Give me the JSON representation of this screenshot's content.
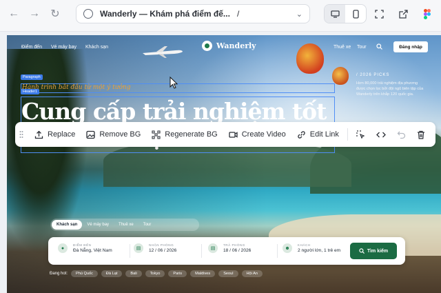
{
  "browser": {
    "url_title": "Wanderly — Khám phá điểm đế...",
    "url_path": "/",
    "icons": [
      "back-icon",
      "forward-icon",
      "reload-icon",
      "globe-icon",
      "chevron-down-icon",
      "desktop-icon",
      "mobile-icon",
      "fullscreen-icon",
      "external-link-icon",
      "figma-icon"
    ]
  },
  "site": {
    "nav_left": [
      "Điểm đến",
      "Vé máy bay",
      "Khách sạn"
    ],
    "brand": "Wanderly",
    "nav_right": [
      "Thuê xe",
      "Tour"
    ],
    "login": "Đăng nhập",
    "picks_title": "/ 2026 PICKS",
    "picks_desc": "Hơn 80,000 trải nghiệm địa phương được chọn lọc bởi đội ngũ biên tập của Wanderly trên khắp 120 quốc gia.",
    "tag_paragraph": "Paragraph",
    "tag_header": "Header1",
    "tagline": "Hành trình bắt đầu từ một ý tưởng",
    "hero_title": "Cung cấp trải nghiệm tốt nhất cho bạn",
    "tabs": [
      "Khách sạn",
      "Vé máy bay",
      "Thuê xe",
      "Tour"
    ],
    "search": {
      "dest_label": "ĐIỂM ĐẾN",
      "dest_value": "Đà Nẵng, Việt Nam",
      "checkin_label": "NHẬN PHÒNG",
      "checkin_value": "12 / 06 / 2026",
      "checkout_label": "TRẢ PHÒNG",
      "checkout_value": "18 / 06 / 2026",
      "guests_label": "KHÁCH",
      "guests_value": "2 người lớn, 1 trẻ em",
      "button": "Tìm kiếm"
    },
    "hot_label": "Đang hot:",
    "hot_chips": [
      "Phú Quốc",
      "Đà Lạt",
      "Bali",
      "Tokyo",
      "Paris",
      "Maldives",
      "Seoul",
      "Hội An"
    ]
  },
  "toolbar": {
    "replace": "Replace",
    "remove_bg": "Remove BG",
    "regenerate_bg": "Regenerate BG",
    "create_video": "Create Video",
    "edit_link": "Edit Link"
  },
  "colors": {
    "accent_green": "#1b6b43",
    "selection_blue": "#4f8ef5",
    "tagline_orange": "#e8a13a"
  }
}
